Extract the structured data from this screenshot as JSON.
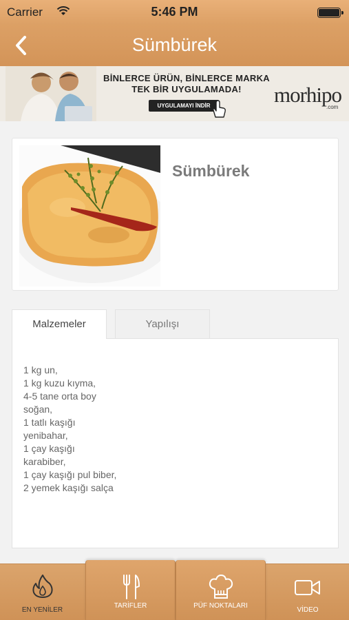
{
  "status": {
    "carrier": "Carrier",
    "time": "5:46 PM",
    "battery_level": 1.0
  },
  "nav": {
    "title": "Sümbürek",
    "back_icon": "chevron-left-icon"
  },
  "banner": {
    "line1": "BİNLERCE ÜRÜN, BİNLERCE MARKA",
    "line2": "TEK BİR UYGULAMADA!",
    "cta": "UYGULAMAYI İNDİR",
    "brand": "morhipo",
    "brand_suffix": ".com"
  },
  "recipe": {
    "title": "Sümbürek"
  },
  "tabs": [
    {
      "label": "Malzemeler",
      "active": true
    },
    {
      "label": "Yapılışı",
      "active": false
    }
  ],
  "ingredients": [
    "1 kg un,",
    "1 kg kuzu kıyma,",
    "4-5 tane orta boy",
    "soğan,",
    "1 tatlı kaşığı",
    "yenibahar,",
    "1 çay kaşığı",
    "karabiber,",
    "1 çay kaşığı pul biber,",
    "2 yemek kaşığı salça"
  ],
  "tabbar": [
    {
      "label": "EN YENİLER",
      "icon": "flame-icon",
      "selected": true
    },
    {
      "label": "TARİFLER",
      "icon": "fork-knife-icon",
      "selected": false
    },
    {
      "label": "PÜF NOKTALARI",
      "icon": "chef-hat-icon",
      "selected": false
    },
    {
      "label": "VİDEO",
      "icon": "video-camera-icon",
      "selected": false
    }
  ],
  "colors": {
    "accent": "#d9a066",
    "title_text": "#7a7a7a",
    "body_text": "#666666"
  }
}
